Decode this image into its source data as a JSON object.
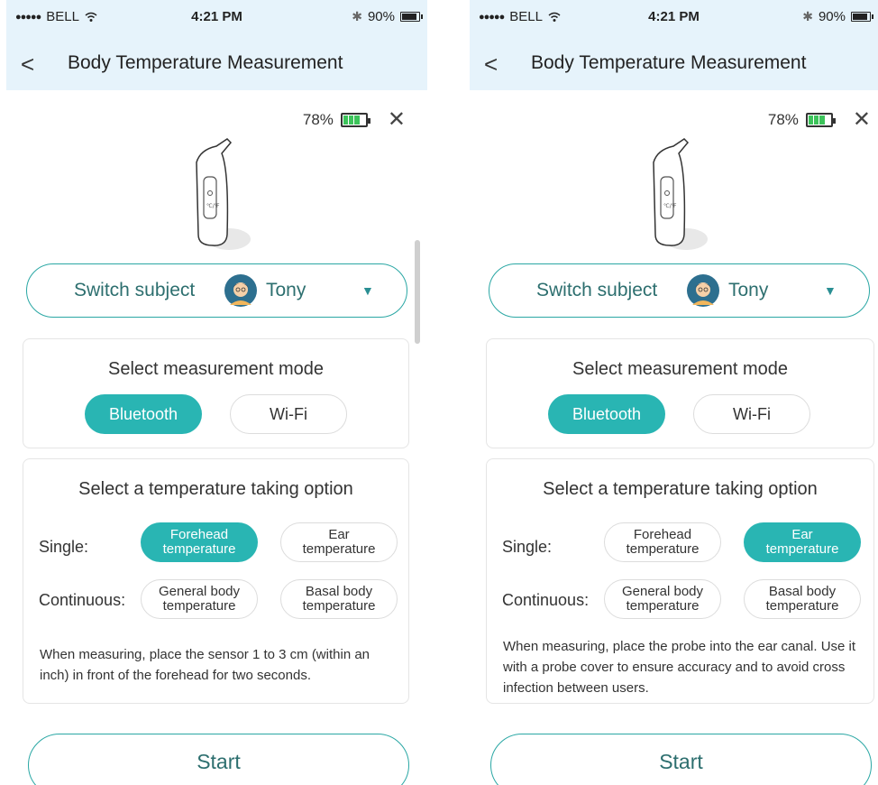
{
  "status": {
    "carrier": "BELL",
    "time": "4:21 PM",
    "battery": "90%"
  },
  "nav": {
    "title": "Body Temperature Measurement"
  },
  "device": {
    "battery": "78%",
    "battery_level": 0.78
  },
  "subject": {
    "switch_label": "Switch subject",
    "name": "Tony"
  },
  "mode": {
    "title": "Select measurement mode",
    "options": [
      "Bluetooth",
      "Wi-Fi"
    ],
    "selected": "Bluetooth"
  },
  "option": {
    "title": "Select a temperature taking option",
    "single_label": "Single:",
    "continuous_label": "Continuous:",
    "forehead": "Forehead\ntemperature",
    "ear": "Ear\ntemperature",
    "general": "General body\ntemperature",
    "basal": "Basal body\ntemperature"
  },
  "screens": [
    {
      "selected_option": "Forehead temperature",
      "description": "When measuring, place the sensor 1 to 3 cm (within an inch) in front of the forehead for two seconds."
    },
    {
      "selected_option": "Ear temperature",
      "description": "When measuring, place the probe into the ear canal. Use it with a probe cover to ensure accuracy and to avoid cross infection between users."
    }
  ],
  "start_label": "Start",
  "colors": {
    "accent": "#29b5b3",
    "header_bg": "#e6f3fb",
    "battery_green": "#3cc35a"
  }
}
